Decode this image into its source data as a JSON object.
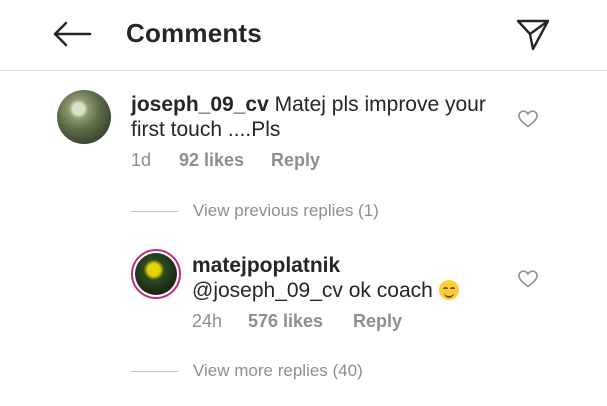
{
  "header": {
    "title": "Comments",
    "back_icon": "back-arrow-icon",
    "share_icon": "paper-plane-icon"
  },
  "comments": [
    {
      "username": "joseph_09_cv",
      "text": "Matej pls improve your first touch ....Pls",
      "time": "1d",
      "likes": "92 likes",
      "reply_label": "Reply",
      "view_replies": "View previous replies (1)",
      "avatar_icon": "avatar"
    },
    {
      "username": "matejpoplatnik",
      "text": "@joseph_09_cv ok coach",
      "emoji": "smiling-face-emoji",
      "time": "24h",
      "likes": "576 likes",
      "reply_label": "Reply",
      "view_replies": "View more replies (40)",
      "avatar_icon": "avatar"
    }
  ],
  "colors": {
    "text": "#262626",
    "muted": "#8e8e8e",
    "story_ring": "#c42a7b"
  }
}
